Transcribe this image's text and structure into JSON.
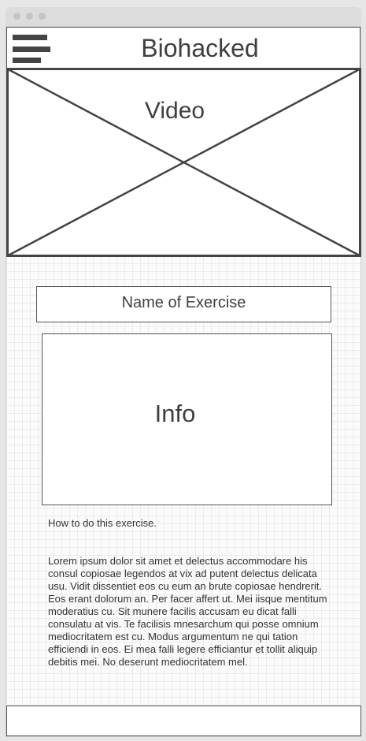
{
  "header": {
    "title": "Biohacked",
    "menu_icon": "hamburger-menu-icon"
  },
  "video": {
    "label": "Video"
  },
  "exercise": {
    "name": "Name of Exercise",
    "info_label": "Info",
    "howto": "How to do this exercise.",
    "description": "Lorem ipsum dolor sit amet et delectus accommodare his consul copiosae legendos at vix ad putent delectus delicata usu. Vidit dissentiet eos cu eum an brute copiosae hendrerit. Eos erant dolorum an. Per facer affert ut. Mei iisque mentitum moderatius cu. Sit munere facilis accusam eu dicat falli consulatu at vis. Te facilisis mnesarchum qui posse omnium mediocritatem est cu. Modus argumentum ne qui tation efficiendi in eos. Ei mea falli legere efficiantur et tollit aliquip debitis mei. No deserunt mediocritatem mel."
  },
  "colors": {
    "stroke": "#444444",
    "background": "#fbfbfb",
    "chrome": "#dcdcdc"
  }
}
